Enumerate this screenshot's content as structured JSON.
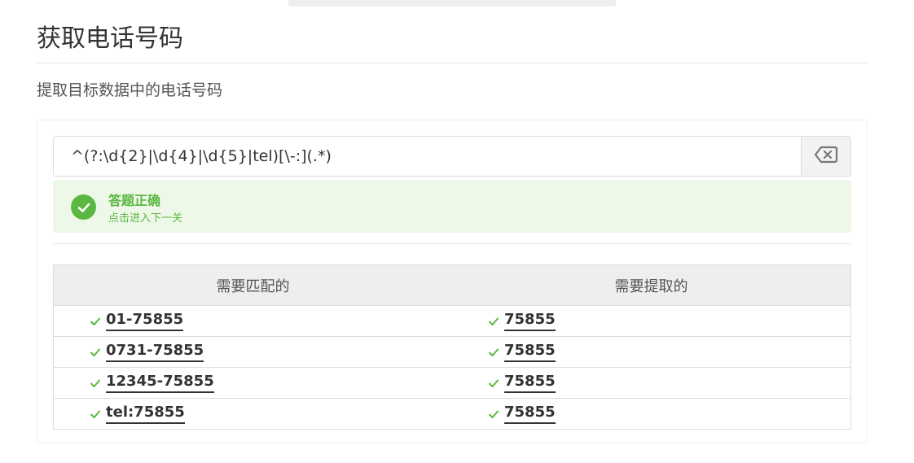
{
  "page": {
    "title": "获取电话号码",
    "description": "提取目标数据中的电话号码"
  },
  "regex_input": {
    "value": "^(?:\\d{2}|\\d{4}|\\d{5}|tel)[\\-:](.*)"
  },
  "alert": {
    "title": "答题正确",
    "subtitle": "点击进入下一关",
    "color": "#5bb741"
  },
  "table": {
    "headers": [
      "需要匹配的",
      "需要提取的"
    ],
    "rows": [
      {
        "match": "01-75855",
        "extract": "75855"
      },
      {
        "match": "0731-75855",
        "extract": "75855"
      },
      {
        "match": "12345-75855",
        "extract": "75855"
      },
      {
        "match": "tel:75855",
        "extract": "75855"
      }
    ]
  },
  "icons": {
    "clear": "backspace-icon",
    "success": "check-circle-icon",
    "row_tick": "check-icon"
  }
}
